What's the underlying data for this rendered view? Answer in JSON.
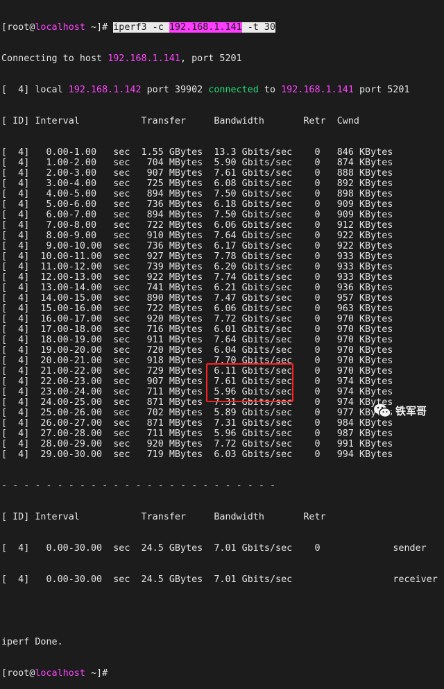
{
  "prompt": {
    "user": "root",
    "at": "@",
    "host": "localhost",
    "open": "[",
    "rest": " ~]# "
  },
  "command": {
    "program": "iperf3 -c ",
    "ip": "192.168.1.141",
    "args": " -t 30"
  },
  "connecting": {
    "prefix": "Connecting to host ",
    "ip": "192.168.1.141",
    "suffix": ", port 5201"
  },
  "local_line": {
    "prefix": "[  4] local ",
    "local_ip": "192.168.1.142",
    "mid": " port 39902 ",
    "connected": "connected",
    "to": " to ",
    "remote_ip": "192.168.1.141",
    "suffix": " port 5201"
  },
  "header": "[ ID] Interval           Transfer     Bandwidth       Retr  Cwnd",
  "rows": [
    [
      "0.00",
      "1.00",
      "1.55 GBytes",
      "13.3 Gbits/sec",
      "0",
      "846 KBytes"
    ],
    [
      "1.00",
      "2.00",
      "704 MBytes",
      "5.90 Gbits/sec",
      "0",
      "874 KBytes"
    ],
    [
      "2.00",
      "3.00",
      "907 MBytes",
      "7.61 Gbits/sec",
      "0",
      "888 KBytes"
    ],
    [
      "3.00",
      "4.00",
      "725 MBytes",
      "6.08 Gbits/sec",
      "0",
      "892 KBytes"
    ],
    [
      "4.00",
      "5.00",
      "894 MBytes",
      "7.50 Gbits/sec",
      "0",
      "898 KBytes"
    ],
    [
      "5.00",
      "6.00",
      "736 MBytes",
      "6.18 Gbits/sec",
      "0",
      "909 KBytes"
    ],
    [
      "6.00",
      "7.00",
      "894 MBytes",
      "7.50 Gbits/sec",
      "0",
      "909 KBytes"
    ],
    [
      "7.00",
      "8.00",
      "722 MBytes",
      "6.06 Gbits/sec",
      "0",
      "912 KBytes"
    ],
    [
      "8.00",
      "9.00",
      "910 MBytes",
      "7.64 Gbits/sec",
      "0",
      "922 KBytes"
    ],
    [
      "9.00",
      "10.00",
      "736 MBytes",
      "6.17 Gbits/sec",
      "0",
      "922 KBytes"
    ],
    [
      "10.00",
      "11.00",
      "927 MBytes",
      "7.78 Gbits/sec",
      "0",
      "933 KBytes"
    ],
    [
      "11.00",
      "12.00",
      "739 MBytes",
      "6.20 Gbits/sec",
      "0",
      "933 KBytes"
    ],
    [
      "12.00",
      "13.00",
      "922 MBytes",
      "7.74 Gbits/sec",
      "0",
      "933 KBytes"
    ],
    [
      "13.00",
      "14.00",
      "741 MBytes",
      "6.21 Gbits/sec",
      "0",
      "936 KBytes"
    ],
    [
      "14.00",
      "15.00",
      "890 MBytes",
      "7.47 Gbits/sec",
      "0",
      "957 KBytes"
    ],
    [
      "15.00",
      "16.00",
      "722 MBytes",
      "6.06 Gbits/sec",
      "0",
      "963 KBytes"
    ],
    [
      "16.00",
      "17.00",
      "920 MBytes",
      "7.72 Gbits/sec",
      "0",
      "970 KBytes"
    ],
    [
      "17.00",
      "18.00",
      "716 MBytes",
      "6.01 Gbits/sec",
      "0",
      "970 KBytes"
    ],
    [
      "18.00",
      "19.00",
      "911 MBytes",
      "7.64 Gbits/sec",
      "0",
      "970 KBytes"
    ],
    [
      "19.00",
      "20.00",
      "720 MBytes",
      "6.04 Gbits/sec",
      "0",
      "970 KBytes"
    ],
    [
      "20.00",
      "21.00",
      "918 MBytes",
      "7.70 Gbits/sec",
      "0",
      "970 KBytes"
    ],
    [
      "21.00",
      "22.00",
      "729 MBytes",
      "6.11 Gbits/sec",
      "0",
      "970 KBytes"
    ],
    [
      "22.00",
      "23.00",
      "907 MBytes",
      "7.61 Gbits/sec",
      "0",
      "974 KBytes"
    ],
    [
      "23.00",
      "24.00",
      "711 MBytes",
      "5.96 Gbits/sec",
      "0",
      "974 KBytes"
    ],
    [
      "24.00",
      "25.00",
      "871 MBytes",
      "7.31 Gbits/sec",
      "0",
      "974 KBytes"
    ],
    [
      "25.00",
      "26.00",
      "702 MBytes",
      "5.89 Gbits/sec",
      "0",
      "977 KBytes"
    ],
    [
      "26.00",
      "27.00",
      "871 MBytes",
      "7.31 Gbits/sec",
      "0",
      "984 KBytes"
    ],
    [
      "27.00",
      "28.00",
      "711 MBytes",
      "5.96 Gbits/sec",
      "0",
      "987 KBytes"
    ],
    [
      "28.00",
      "29.00",
      "920 MBytes",
      "7.72 Gbits/sec",
      "0",
      "991 KBytes"
    ],
    [
      "29.00",
      "30.00",
      "719 MBytes",
      "6.03 Gbits/sec",
      "0",
      "994 KBytes"
    ]
  ],
  "separator": "- - - - - - - - - - - - - - - - - - - - - - - - -",
  "summary_header": "[ ID] Interval           Transfer     Bandwidth       Retr",
  "summary": [
    {
      "line": "[  4]   0.00-30.00  sec  24.5 GBytes  7.01 Gbits/sec    0             sender"
    },
    {
      "line": "[  4]   0.00-30.00  sec  24.5 GBytes  7.01 Gbits/sec                  receiver"
    }
  ],
  "done": "iperf Done.",
  "watermark": "铁军哥",
  "colors": {
    "background": "#1c1c1c",
    "text": "#e4e4e4",
    "magenta": "#ff44ff",
    "green": "#22dd77",
    "highlight_box": "#ff2020"
  }
}
